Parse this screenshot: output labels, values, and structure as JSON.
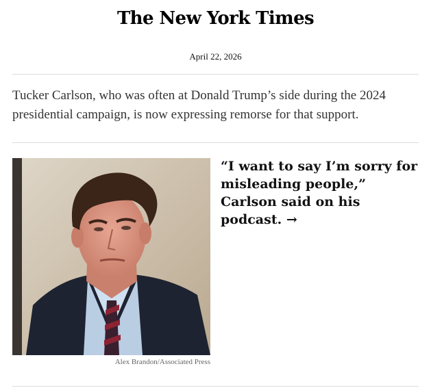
{
  "masthead": {
    "logo_text": "The New York Times"
  },
  "newsletter": {
    "date": "April 22, 2026"
  },
  "intro": {
    "text": "Tucker Carlson, who was often at Donald Trump’s side during the 2024 presidential campaign, is now expressing remorse for that support."
  },
  "story": {
    "headline": "“I want to say I’m sorry for misleading people,” Carlson said on his podcast. →",
    "photo_credit": "Alex Brandon/Associated Press"
  }
}
